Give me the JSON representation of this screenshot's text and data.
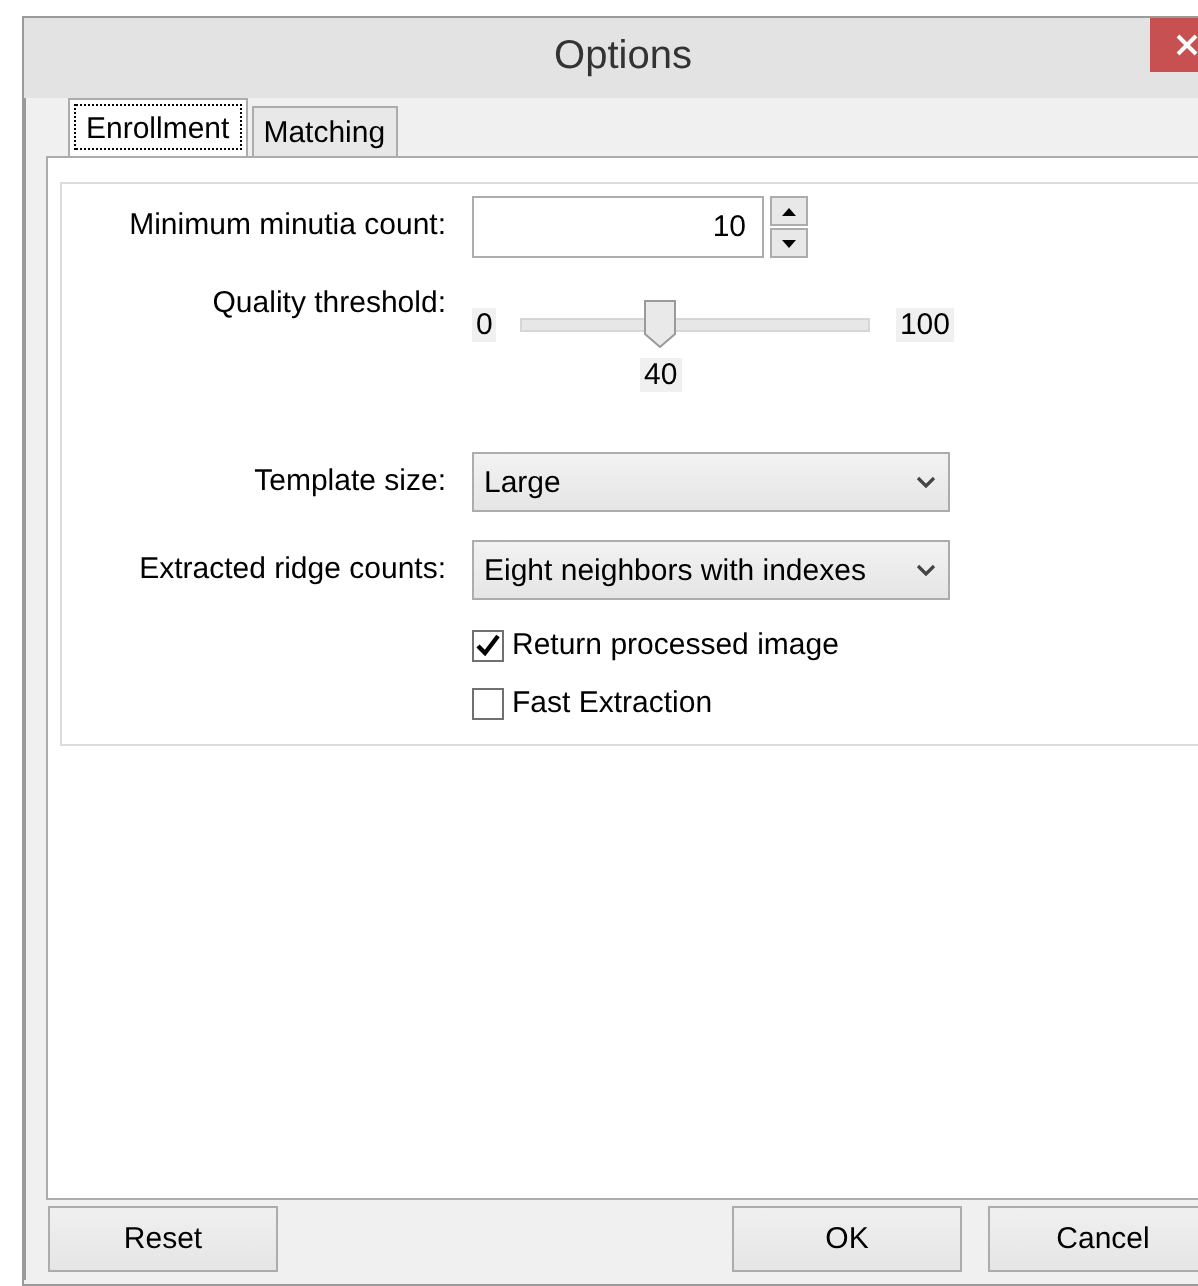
{
  "window": {
    "title": "Options"
  },
  "tabs": [
    {
      "label": "Enrollment",
      "selected": true
    },
    {
      "label": "Matching",
      "selected": false
    }
  ],
  "settings": [
    {
      "kind": "spin",
      "label": "Minimum minutia count:",
      "value": "10"
    },
    {
      "kind": "slider",
      "label": "Quality threshold:",
      "min_label": "0",
      "max_label": "100",
      "reading": "40",
      "level": 0.4
    },
    {
      "kind": "dropdown",
      "label": "Template size:",
      "value": "Large"
    },
    {
      "kind": "dropdown",
      "label": "Extracted ridge counts:",
      "value": "Eight neighbors with indexes"
    },
    {
      "kind": "checkbox",
      "label": "Return processed image",
      "checked": true
    },
    {
      "kind": "checkbox",
      "label": "Fast Extraction",
      "checked": false
    }
  ],
  "buttons_left": [
    "Reset"
  ],
  "buttons_right": [
    "OK",
    "Cancel"
  ]
}
